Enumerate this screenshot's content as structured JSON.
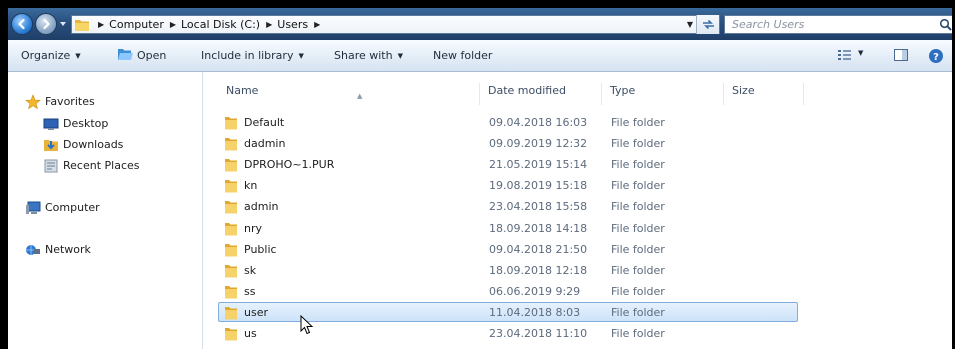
{
  "window": {
    "breadcrumb": [
      "Computer",
      "Local Disk (C:)",
      "Users"
    ],
    "search_placeholder": "Search Users"
  },
  "toolbar": {
    "organize": "Organize",
    "open": "Open",
    "include_in_library": "Include in library",
    "share_with": "Share with",
    "new_folder": "New folder"
  },
  "nav": {
    "favorites": "Favorites",
    "desktop": "Desktop",
    "downloads": "Downloads",
    "recent_places": "Recent Places",
    "computer": "Computer",
    "network": "Network"
  },
  "columns": {
    "name": "Name",
    "date_modified": "Date modified",
    "type": "Type",
    "size": "Size"
  },
  "files": [
    {
      "name": "Default",
      "date": "09.04.2018 16:03",
      "type": "File folder",
      "selected": false
    },
    {
      "name": "dadmin",
      "date": "09.09.2019 12:32",
      "type": "File folder",
      "selected": false
    },
    {
      "name": "DPROHO~1.PUR",
      "date": "21.05.2019 15:14",
      "type": "File folder",
      "selected": false
    },
    {
      "name": "kn",
      "date": "19.08.2019 15:18",
      "type": "File folder",
      "selected": false
    },
    {
      "name": "admin",
      "date": "23.04.2018 15:58",
      "type": "File folder",
      "selected": false
    },
    {
      "name": "nry",
      "date": "18.09.2018 14:18",
      "type": "File folder",
      "selected": false
    },
    {
      "name": "Public",
      "date": "09.04.2018 21:50",
      "type": "File folder",
      "selected": false
    },
    {
      "name": "sk",
      "date": "18.09.2018 12:18",
      "type": "File folder",
      "selected": false
    },
    {
      "name": "ss",
      "date": "06.06.2019 9:29",
      "type": "File folder",
      "selected": false
    },
    {
      "name": "user",
      "date": "11.04.2018 8:03",
      "type": "File folder",
      "selected": true
    },
    {
      "name": "us",
      "date": "23.04.2018 11:10",
      "type": "File folder",
      "selected": false
    }
  ],
  "colors": {
    "selection_fill": "#cde3f9",
    "selection_border": "#84acdd",
    "folder_yellow": "#f2c94c"
  }
}
